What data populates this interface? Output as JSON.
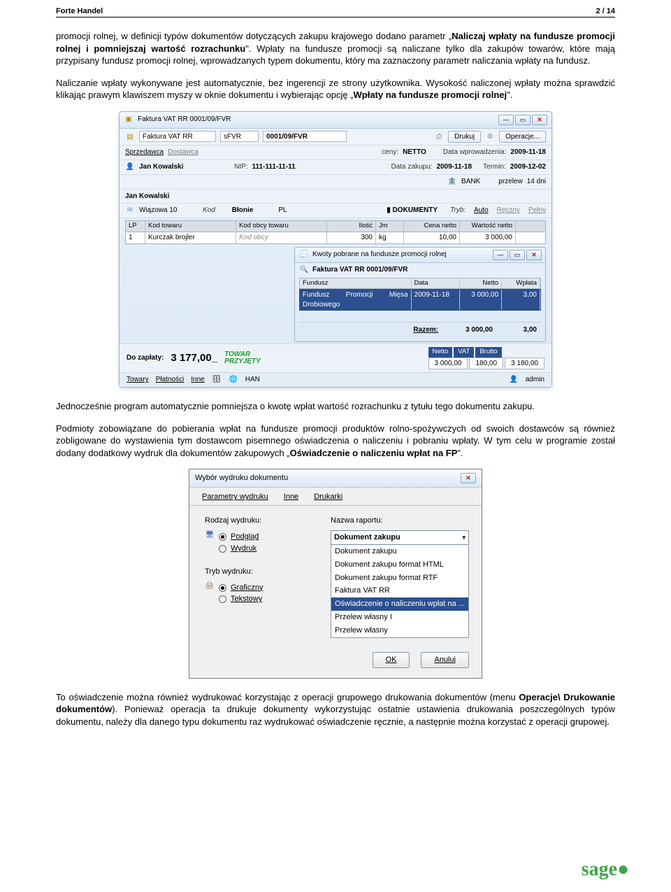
{
  "header": {
    "left": "Forte Handel",
    "right": "2 / 14"
  },
  "para1_a": "promocji rolnej, w definicji typów dokumentów dotyczących zakupu krajowego dodano parametr „",
  "para1_b": "Naliczaj wpłaty na fundusze promocji rolnej i pomniejszaj wartość rozrachunku",
  "para1_c": "\". Wpłaty na fundusze promocji są naliczane tylko dla zakupów towarów, które mają przypisany fundusz promocji rolnej, wprowadzanych typem dokumentu, który ma zaznaczony parametr naliczania wpłaty na fundusz.",
  "para2_a": "Naliczanie wpłaty wykonywane jest automatycznie, bez ingerencji ze strony użytkownika. Wysokość naliczonej wpłaty można sprawdzić klikając prawym klawiszem myszy w oknie dokumentu i wybierając opcję „",
  "para2_b": "Wpłaty na fundusze promocji rolnej",
  "para2_c": "\".",
  "para3": "Jednocześnie program automatycznie pomniejsza o kwotę wpłat wartość rozrachunku z tytułu tego dokumentu zakupu.",
  "para4_a": "Podmioty zobowiązane do pobierania wpłat na fundusze promocji produktów rolno-spożywczych od swoich dostawców są również zobligowane do wystawienia tym dostawcom pisemnego oświadczenia o naliczeniu i pobraniu wpłaty. W tym celu w programie został dodany dodatkowy wydruk dla dokumentów zakupowych „",
  "para4_b": "Oświadczenie o naliczeniu wpłat na FP",
  "para4_c": "\".",
  "para5_a": "To oświadczenie można również wydrukować korzystając z operacji grupowego drukowania dokumentów (menu ",
  "para5_b": "Operacje\\ Drukowanie dokumentów",
  "para5_c": "). Ponieważ operacja ta drukuje dokumenty wykorzystując ostatnie ustawienia drukowania poszczególnych typów dokumentu, należy dla danego typu dokumentu raz wydrukować oświadczenie ręcznie, a następnie można korzystać z operacji grupowej.",
  "win1": {
    "title": "Faktura VAT RR 0001/09/FVR",
    "doctype": "Faktura VAT RR",
    "code": "sFVR",
    "number": "0001/09/FVR",
    "print": "Drukuj",
    "ops": "Operacje...",
    "tab_sprz": "Sprzedawca",
    "tab_dost": "Dostawca",
    "ceny_lbl": "ceny:",
    "ceny_val": "NETTO",
    "datawpr_lbl": "Data wprowadzenia:",
    "datawpr_val": "2009-11-18",
    "seller": "Jan Kowalski",
    "nip_lbl": "NIP:",
    "nip_val": "111-111-11-11",
    "datazak_lbl": "Data zakupu:",
    "datazak_val": "2009-11-18",
    "termin_lbl": "Termin:",
    "termin_val": "2009-12-02",
    "bank": "BANK",
    "przelew": "przelew",
    "dni": "14 dni",
    "seller2": "Jan Kowalski",
    "addr": "Wiązowa 10",
    "kod_lbl": "Kod",
    "city": "Błonie",
    "country": "PL",
    "dokumenty": "DOKUMENTY",
    "tryb_lbl": "Tryb:",
    "tryb_auto": "Auto",
    "tryb_recz": "Ręczny",
    "tryb_pelny": "Pełny",
    "grid_h": {
      "lp": "LP",
      "kod": "Kod towaru",
      "obcy": "Kod obcy towaru",
      "il": "Ilość",
      "jm": "Jm",
      "cn": "Cena netto",
      "wn": "Wartość netto"
    },
    "grid_r": {
      "lp": "1",
      "kod": "Kurczak brojler",
      "obcy": "Kod obcy",
      "il": "300",
      "jm": "kg",
      "cn": "10,00",
      "wn": "3 000,00"
    },
    "sub_title": "Kwoty pobrane na fundusze promocji rolnej",
    "sub_doc": "Faktura VAT RR 0001/09/FVR",
    "fund_h": {
      "f": "Fundusz",
      "d": "Data",
      "n": "Netto",
      "w": "Wpłata"
    },
    "fund_r": {
      "f": "Fundusz Promocji Mięsa Drobiowego",
      "d": "2009-11-18",
      "n": "3 000,00",
      "w": "3,00"
    },
    "razem_lbl": "Razem:",
    "razem_n": "3 000,00",
    "razem_w": "3,00",
    "dozap_lbl": "Do zapłaty:",
    "dozap_val": "3 177,00_",
    "towar_l1": "TOWAR",
    "towar_l2": "PRZYJĘTY",
    "sum_netto_h": "Netto",
    "sum_vat_h": "VAT",
    "sum_brutto_h": "Brutto",
    "sum_netto": "3 000,00",
    "sum_vat": "180,00",
    "sum_brutto": "3 180,00",
    "tabs_bottom": {
      "towary": "Towary",
      "plat": "Płatności",
      "inne": "Inne",
      "han": "HAN",
      "admin": "admin"
    }
  },
  "win2": {
    "title": "Wybór wydruku dokumentu",
    "tab_param": "Parametry wydruku",
    "tab_inne": "Inne",
    "tab_druk": "Drukarki",
    "rodzaj_lbl": "Rodzaj wydruku:",
    "podglad": "Podgląd",
    "wydruk": "Wydruk",
    "tryb_lbl": "Tryb wydruku:",
    "graficzny": "Graficzny",
    "tekstowy": "Tekstowy",
    "nazwa_lbl": "Nazwa raportu:",
    "combo_val": "Dokument zakupu",
    "list": [
      "Dokument zakupu",
      "Dokument zakupu format HTML",
      "Dokument zakupu format RTF",
      "Faktura VAT RR",
      "Oświadczenie o naliczeniu wpłat na ...",
      "Przelew własny I",
      "Przelew własny"
    ],
    "ok": "OK",
    "anuluj": "Anuluj"
  },
  "logo": "sage"
}
